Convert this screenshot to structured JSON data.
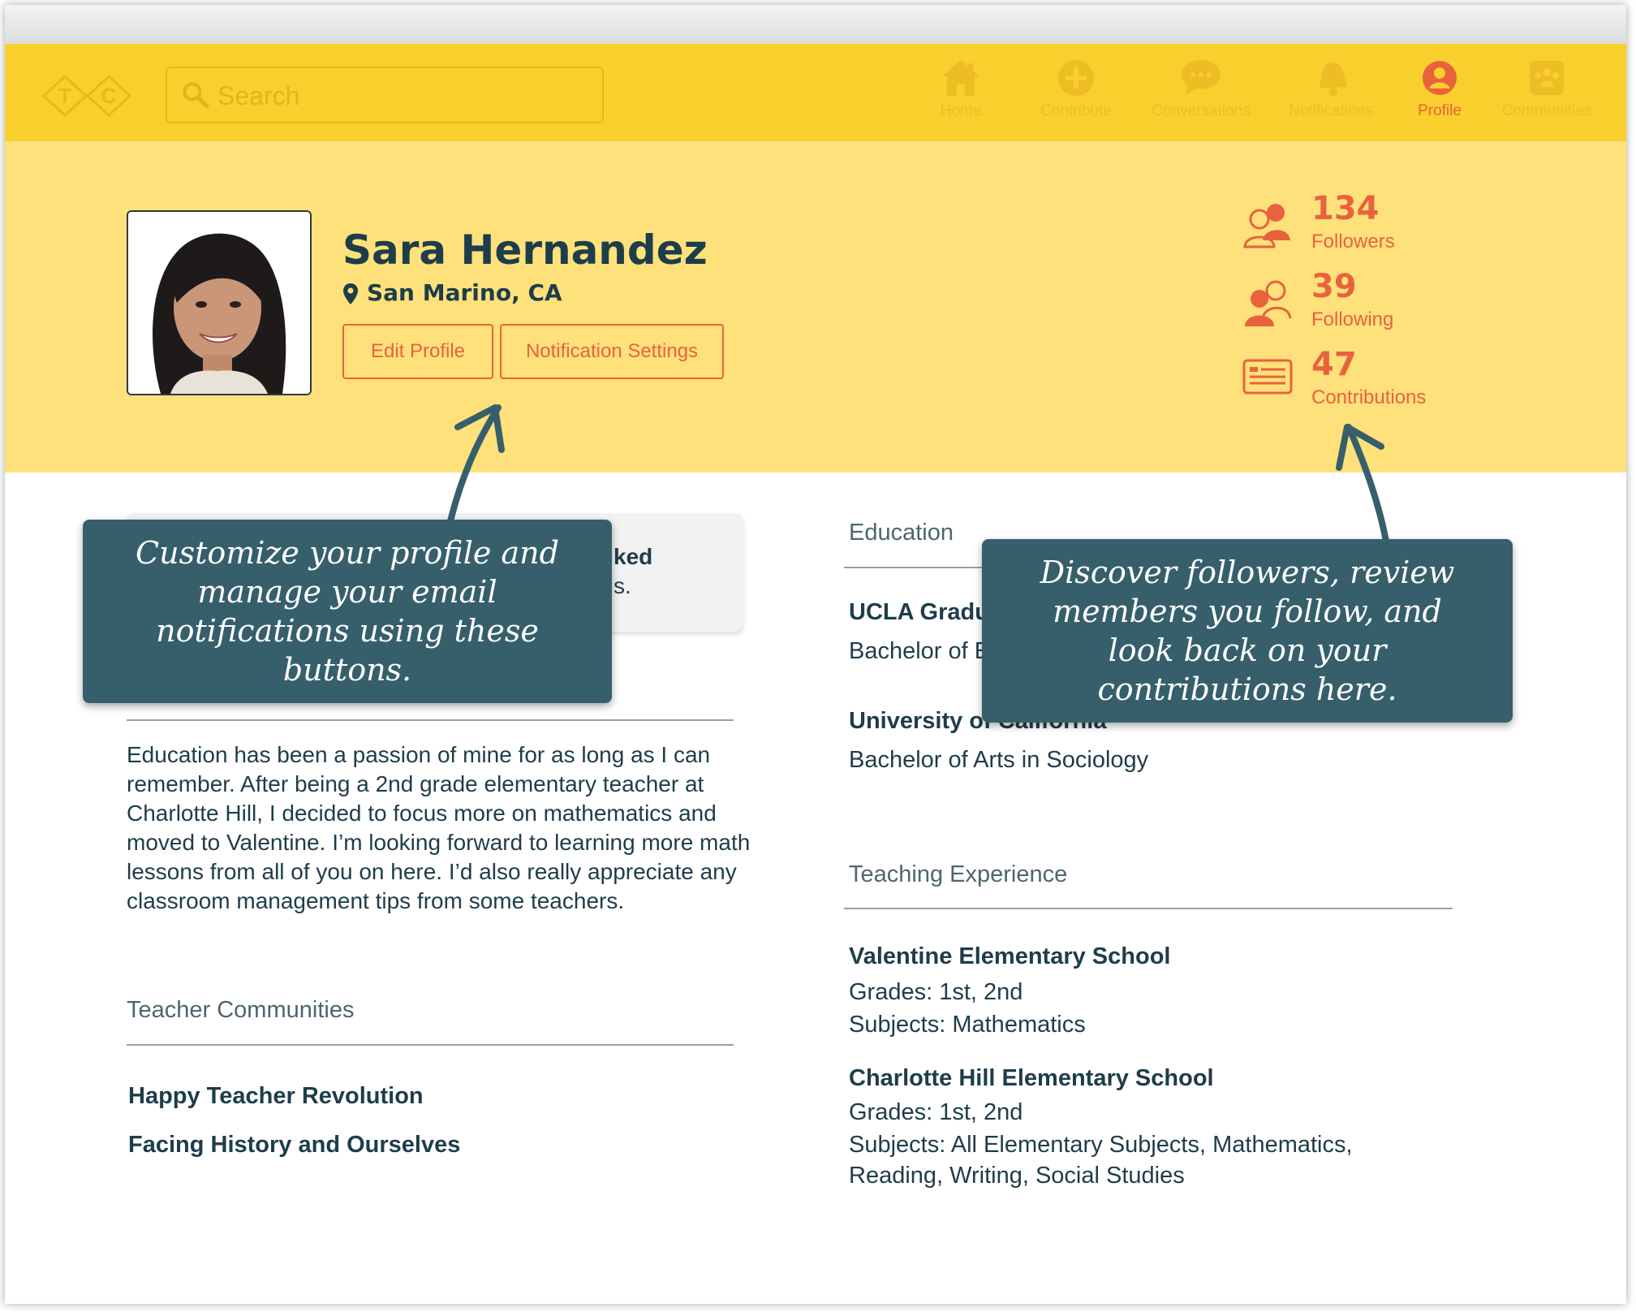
{
  "search": {
    "placeholder": "Search"
  },
  "logo": {
    "letter_left": "T",
    "letter_right": "C"
  },
  "nav": [
    {
      "label": "Home",
      "icon": "home-icon"
    },
    {
      "label": "Contribute",
      "icon": "plus-circle-icon"
    },
    {
      "label": "Conversations",
      "icon": "chat-bubble-icon"
    },
    {
      "label": "Notifications",
      "icon": "bell-icon"
    },
    {
      "label": "Profile",
      "icon": "user-circle-icon",
      "active": true
    },
    {
      "label": "Communities",
      "icon": "group-icon"
    }
  ],
  "profile": {
    "name": "Sara Hernandez",
    "location": "San Marino, CA",
    "edit_button": "Edit Profile",
    "notification_button": "Notification Settings"
  },
  "stats": [
    {
      "value": "134",
      "label": "Followers",
      "icon": "followers-icon"
    },
    {
      "value": "39",
      "label": "Following",
      "icon": "following-icon"
    },
    {
      "value": "47",
      "label": "Contributions",
      "icon": "contributions-icon"
    }
  ],
  "card": {
    "line1": "ked",
    "line2": "s."
  },
  "about": {
    "text": "Education has been a passion of mine for as long as I can remember. After being a 2nd grade elementary teacher at Charlotte Hill, I decided to focus more on mathematics and moved to Valentine. I’m looking forward to learning more math lessons from all of you on here. I’d also really appreciate any classroom management tips from some teachers."
  },
  "communities": {
    "title": "Teacher Communities",
    "items": [
      "Happy Teacher Revolution",
      "Facing History and Ourselves"
    ]
  },
  "education": {
    "title": "Education",
    "entries": [
      {
        "school": "UCLA Gradu",
        "degree": "Bachelor of E"
      },
      {
        "school": "University of California",
        "degree": "Bachelor of Arts in Sociology"
      }
    ]
  },
  "teaching": {
    "title": "Teaching Experience",
    "entries": [
      {
        "school": "Valentine Elementary School",
        "grades": "Grades: 1st, 2nd",
        "subjects": "Subjects: Mathematics"
      },
      {
        "school": "Charlotte Hill Elementary School",
        "grades": "Grades: 1st, 2nd",
        "subjects": "Subjects: All Elementary Subjects, Mathematics,",
        "subjects2": "Reading, Writing, Social Studies"
      }
    ]
  },
  "tooltips": {
    "left": "Customize your profile and manage your email notifications using these buttons.",
    "right": "Discover followers, review members you follow, and look back on your contributions here."
  },
  "colors": {
    "topbar": "#f8cf2c",
    "hero": "#fee17a",
    "accent": "#e9623e",
    "tooltip": "#365f6b",
    "text": "#1e3d4a"
  }
}
